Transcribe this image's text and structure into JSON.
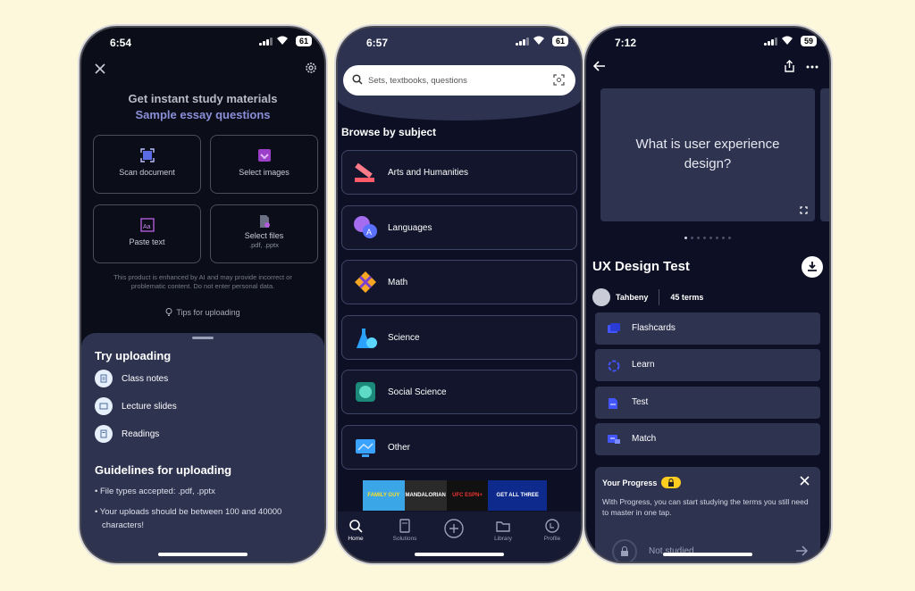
{
  "phone1": {
    "status": {
      "time": "6:54",
      "battery": "61"
    },
    "title": "Get instant study materials",
    "subtitle": "Sample essay questions",
    "tiles": [
      {
        "label": "Scan document",
        "sub": ""
      },
      {
        "label": "Select images",
        "sub": ""
      },
      {
        "label": "Paste text",
        "sub": ""
      },
      {
        "label": "Select files",
        "sub": ".pdf, .pptx"
      }
    ],
    "disclaimer": "This product is enhanced by AI and may provide incorrect or problematic content. Do not enter personal data.",
    "tips": "Tips for uploading",
    "sheet": {
      "try_title": "Try uploading",
      "items": [
        "Class notes",
        "Lecture slides",
        "Readings"
      ],
      "guide_title": "Guidelines for uploading",
      "bullets": [
        "File types accepted: .pdf, .pptx",
        "Your uploads should be between 100 and 40000 characters!"
      ]
    }
  },
  "phone2": {
    "status": {
      "time": "6:57",
      "battery": "61"
    },
    "search_placeholder": "Sets, textbooks, questions",
    "browse_title": "Browse by subject",
    "subjects": [
      "Arts and Humanities",
      "Languages",
      "Math",
      "Science",
      "Social Science",
      "Other"
    ],
    "ad": {
      "text1": "FAMILY GUY",
      "text2": "MANDALORIAN",
      "text3": "UFC ESPN+",
      "text4": "GET ALL THREE"
    },
    "tabs": [
      "Home",
      "Solutions",
      "",
      "Library",
      "Profile"
    ]
  },
  "phone3": {
    "status": {
      "time": "7:12",
      "battery": "59"
    },
    "card_question": "What is user experience design?",
    "set_title": "UX Design Test",
    "author": "Tahbeny",
    "terms": "45 terms",
    "modes": [
      "Flashcards",
      "Learn",
      "Test",
      "Match"
    ],
    "progress": {
      "title": "Your Progress",
      "desc": "With Progress, you can start studying the terms you still need to master in one tap.",
      "not_studied": "Not studied"
    }
  },
  "colors": {
    "background": "#fdf7dc",
    "accent": "#4255ff",
    "sheet": "#2e3350"
  }
}
